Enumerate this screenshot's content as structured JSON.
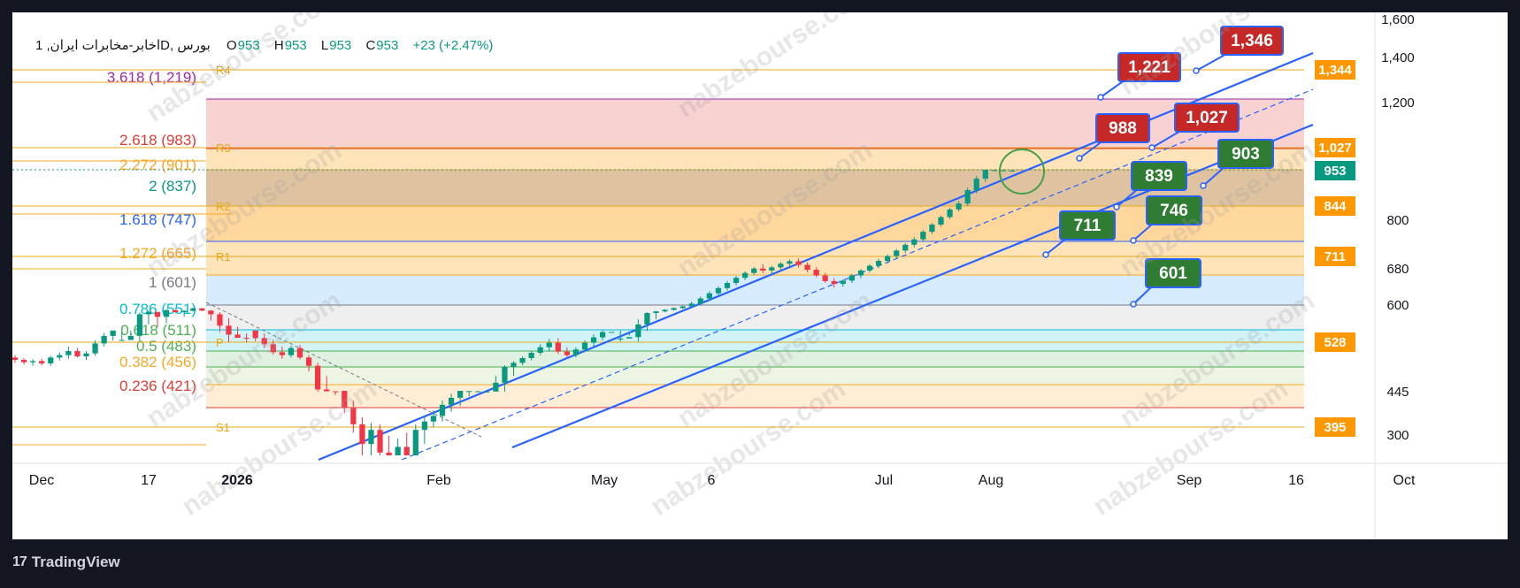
{
  "header": {
    "symbol": "اخابر-مخابرات ایران, 1D, بورس",
    "o_label": "O",
    "o": "953",
    "h_label": "H",
    "h": "953",
    "l_label": "L",
    "l": "953",
    "c_label": "C",
    "c": "953",
    "change": "+23 (+2.47%)"
  },
  "brand": "TradingView",
  "watermark": "nabzebourse.com",
  "colors": {
    "up": "#089981",
    "down": "#f23645",
    "channel": "#2962ff",
    "target_red": "#c62828",
    "target_green": "#2e7d32",
    "axis_tag_orange": "#ff9800",
    "last_price": "#089981"
  },
  "chart_data": {
    "type": "candlestick",
    "price_axis_ticks": [
      "1,600",
      "1,400",
      "1,200",
      "800",
      "680",
      "600",
      "445",
      "300"
    ],
    "time_axis_ticks": [
      "Dec",
      "17",
      "2026",
      "Feb",
      "May",
      "6",
      "Jul",
      "Aug",
      "Sep",
      "16",
      "Oct"
    ],
    "ylim": [
      385,
      1620
    ],
    "fib_levels": [
      {
        "label": "3.618 (1,219)",
        "price": 1219,
        "color": "#9c27b0"
      },
      {
        "label": "2.618 (983)",
        "price": 983,
        "color": "#e53935"
      },
      {
        "label": "2.272 (901)",
        "price": 901,
        "color": "#f9a825"
      },
      {
        "label": "2 (837)",
        "price": 837,
        "color": "#089981"
      },
      {
        "label": "1.618 (747)",
        "price": 747,
        "color": "#2962ff"
      },
      {
        "label": "1.272 (665)",
        "price": 665,
        "color": "#f9a825"
      },
      {
        "label": "1 (601)",
        "price": 601,
        "color": "#787b86"
      },
      {
        "label": "0.786 (551)",
        "price": 551,
        "color": "#00bcd4"
      },
      {
        "label": "0.618 (511)",
        "price": 511,
        "color": "#4caf50"
      },
      {
        "label": "0.5 (483)",
        "price": 483,
        "color": "#4caf50"
      },
      {
        "label": "0.382 (456)",
        "price": 456,
        "color": "#f9a825"
      },
      {
        "label": "0.236 (421)",
        "price": 421,
        "color": "#e53935"
      }
    ],
    "pivot_levels": [
      {
        "label": "R4",
        "price": 1344
      },
      {
        "label": "R3",
        "price": 1027
      },
      {
        "label": "R2",
        "price": 844
      },
      {
        "label": "R1",
        "price": 711
      },
      {
        "label": "P",
        "price": 528
      },
      {
        "label": "S1",
        "price": 395
      }
    ],
    "axis_tags": [
      {
        "text": "1,344",
        "price": 1344,
        "color": "#ff9800"
      },
      {
        "text": "1,027",
        "price": 1027,
        "color": "#ff9800"
      },
      {
        "text": "953",
        "price": 953,
        "color": "#089981"
      },
      {
        "text": "844",
        "price": 844,
        "color": "#ff9800"
      },
      {
        "text": "711",
        "price": 711,
        "color": "#ff9800"
      },
      {
        "text": "528",
        "price": 528,
        "color": "#ff9800"
      },
      {
        "text": "395",
        "price": 395,
        "color": "#ff9800"
      }
    ],
    "targets": [
      {
        "text": "1,346",
        "kind": "resistance"
      },
      {
        "text": "1,221",
        "kind": "resistance"
      },
      {
        "text": "1,027",
        "kind": "resistance"
      },
      {
        "text": "988",
        "kind": "resistance"
      },
      {
        "text": "903",
        "kind": "support"
      },
      {
        "text": "839",
        "kind": "support"
      },
      {
        "text": "746",
        "kind": "support"
      },
      {
        "text": "711",
        "kind": "support"
      },
      {
        "text": "601",
        "kind": "support"
      }
    ],
    "last_price": 953,
    "candles_ohlc": [
      [
        472,
        476,
        463,
        468
      ],
      [
        468,
        471,
        460,
        464
      ],
      [
        464,
        469,
        458,
        466
      ],
      [
        466,
        470,
        459,
        462
      ],
      [
        462,
        475,
        458,
        472
      ],
      [
        472,
        480,
        467,
        476
      ],
      [
        476,
        489,
        470,
        483
      ],
      [
        483,
        487,
        472,
        474
      ],
      [
        474,
        483,
        468,
        479
      ],
      [
        479,
        497,
        475,
        493
      ],
      [
        493,
        507,
        489,
        503
      ],
      [
        503,
        516,
        497,
        512
      ],
      [
        512,
        529,
        508,
        525
      ],
      [
        525,
        537,
        519,
        533
      ],
      [
        533,
        554,
        529,
        550
      ],
      [
        550,
        562,
        542,
        558
      ],
      [
        558,
        552,
        540,
        548
      ],
      [
        548,
        574,
        543,
        569
      ],
      [
        569,
        575,
        552,
        556
      ],
      [
        556,
        568,
        548,
        565
      ],
      [
        565,
        584,
        560,
        580
      ],
      [
        580,
        583,
        562,
        566
      ],
      [
        566,
        569,
        545,
        550
      ],
      [
        550,
        555,
        536,
        541
      ],
      [
        541,
        547,
        528,
        534
      ],
      [
        534,
        540,
        518,
        522
      ],
      [
        522,
        528,
        506,
        510
      ],
      [
        510,
        516,
        496,
        500
      ],
      [
        500,
        506,
        487,
        492
      ],
      [
        492,
        498,
        477,
        481
      ],
      [
        481,
        489,
        470,
        476
      ],
      [
        476,
        490,
        472,
        487
      ],
      [
        487,
        491,
        469,
        472
      ],
      [
        472,
        476,
        454,
        458
      ],
      [
        458,
        463,
        442,
        446
      ],
      [
        446,
        452,
        430,
        434
      ],
      [
        434,
        440,
        418,
        422
      ],
      [
        422,
        428,
        405,
        409
      ],
      [
        409,
        414,
        393,
        397
      ],
      [
        397,
        402,
        385,
        389
      ],
      [
        389,
        398,
        383,
        394
      ],
      [
        394,
        397,
        382,
        386
      ],
      [
        386,
        392,
        380,
        383
      ],
      [
        383,
        391,
        380,
        388
      ],
      [
        388,
        393,
        381,
        384
      ],
      [
        384,
        397,
        381,
        394
      ],
      [
        394,
        402,
        389,
        399
      ],
      [
        399,
        407,
        395,
        403
      ],
      [
        403,
        414,
        399,
        411
      ],
      [
        411,
        419,
        406,
        416
      ],
      [
        416,
        424,
        410,
        421
      ],
      [
        421,
        431,
        417,
        428
      ],
      [
        428,
        437,
        424,
        434
      ],
      [
        434,
        444,
        430,
        441
      ],
      [
        441,
        452,
        437,
        449
      ],
      [
        449,
        459,
        445,
        456
      ],
      [
        456,
        466,
        452,
        463
      ],
      [
        463,
        474,
        459,
        471
      ],
      [
        471,
        483,
        467,
        480
      ],
      [
        480,
        492,
        476,
        488
      ],
      [
        488,
        499,
        482,
        494
      ],
      [
        494,
        500,
        478,
        482
      ],
      [
        482,
        488,
        472,
        476
      ],
      [
        476,
        488,
        472,
        485
      ],
      [
        485,
        497,
        481,
        494
      ],
      [
        494,
        505,
        489,
        501
      ],
      [
        501,
        512,
        497,
        508
      ],
      [
        508,
        519,
        503,
        514
      ],
      [
        514,
        527,
        510,
        523
      ],
      [
        523,
        536,
        519,
        532
      ],
      [
        532,
        546,
        527,
        542
      ],
      [
        542,
        556,
        537,
        551
      ],
      [
        551,
        565,
        546,
        561
      ],
      [
        561,
        575,
        556,
        571
      ],
      [
        571,
        586,
        566,
        582
      ],
      [
        582,
        597,
        577,
        593
      ],
      [
        593,
        608,
        588,
        604
      ],
      [
        604,
        619,
        599,
        615
      ],
      [
        615,
        630,
        610,
        626
      ],
      [
        626,
        641,
        621,
        637
      ],
      [
        637,
        652,
        632,
        648
      ],
      [
        648,
        663,
        643,
        659
      ],
      [
        659,
        674,
        654,
        670
      ],
      [
        670,
        685,
        665,
        681
      ],
      [
        681,
        692,
        670,
        676
      ],
      [
        676,
        688,
        666,
        684
      ],
      [
        684,
        697,
        678,
        693
      ],
      [
        693,
        704,
        687,
        699
      ],
      [
        699,
        706,
        684,
        690
      ],
      [
        690,
        696,
        672,
        678
      ],
      [
        678,
        684,
        660,
        664
      ],
      [
        664,
        670,
        648,
        652
      ],
      [
        652,
        658,
        638,
        646
      ],
      [
        646,
        656,
        640,
        653
      ],
      [
        653,
        668,
        648,
        664
      ],
      [
        664,
        680,
        658,
        676
      ],
      [
        676,
        692,
        671,
        688
      ],
      [
        688,
        705,
        682,
        700
      ],
      [
        700,
        716,
        694,
        712
      ],
      [
        712,
        729,
        706,
        725
      ],
      [
        725,
        743,
        719,
        739
      ],
      [
        739,
        758,
        733,
        752
      ],
      [
        752,
        775,
        747,
        771
      ],
      [
        771,
        793,
        765,
        789
      ],
      [
        789,
        812,
        784,
        808
      ],
      [
        808,
        832,
        803,
        828
      ],
      [
        828,
        852,
        823,
        848
      ],
      [
        848,
        873,
        843,
        869
      ],
      [
        869,
        891,
        864,
        887
      ],
      [
        887,
        910,
        882,
        906
      ],
      [
        906,
        926,
        900,
        922
      ],
      [
        922,
        936,
        917,
        930
      ],
      [
        930,
        953,
        926,
        953
      ]
    ]
  }
}
